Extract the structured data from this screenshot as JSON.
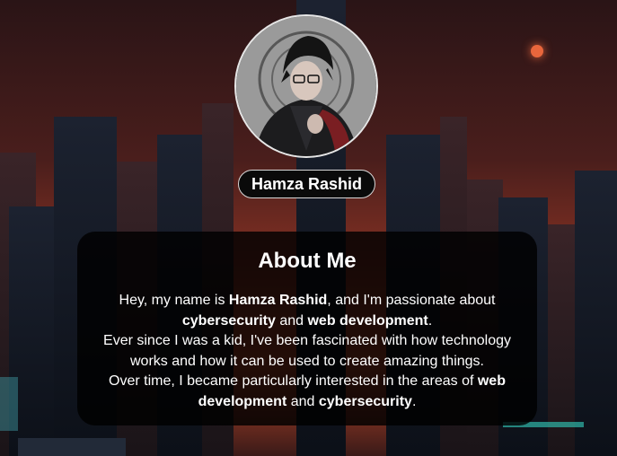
{
  "profile": {
    "name": "Hamza Rashid"
  },
  "about": {
    "title": "About Me",
    "line1_a": "Hey, my name is ",
    "line1_b": "Hamza Rashid",
    "line1_c": ", and I'm passionate about",
    "line2_a": "cybersecurity",
    "line2_b": " and ",
    "line2_c": "web development",
    "line2_d": ".",
    "line3": "Ever since I was a kid, I've been fascinated with how technology",
    "line4": "works and how it can be used to create amazing things.",
    "line5_a": "Over time, I became particularly interested in the areas of ",
    "line5_b": "web",
    "line6_a": "development",
    "line6_b": " and ",
    "line6_c": "cybersecurity",
    "line6_d": "."
  },
  "colors": {
    "card_background": "#000000",
    "pill_border": "#d8d8d8",
    "sun": "#e8663c"
  }
}
